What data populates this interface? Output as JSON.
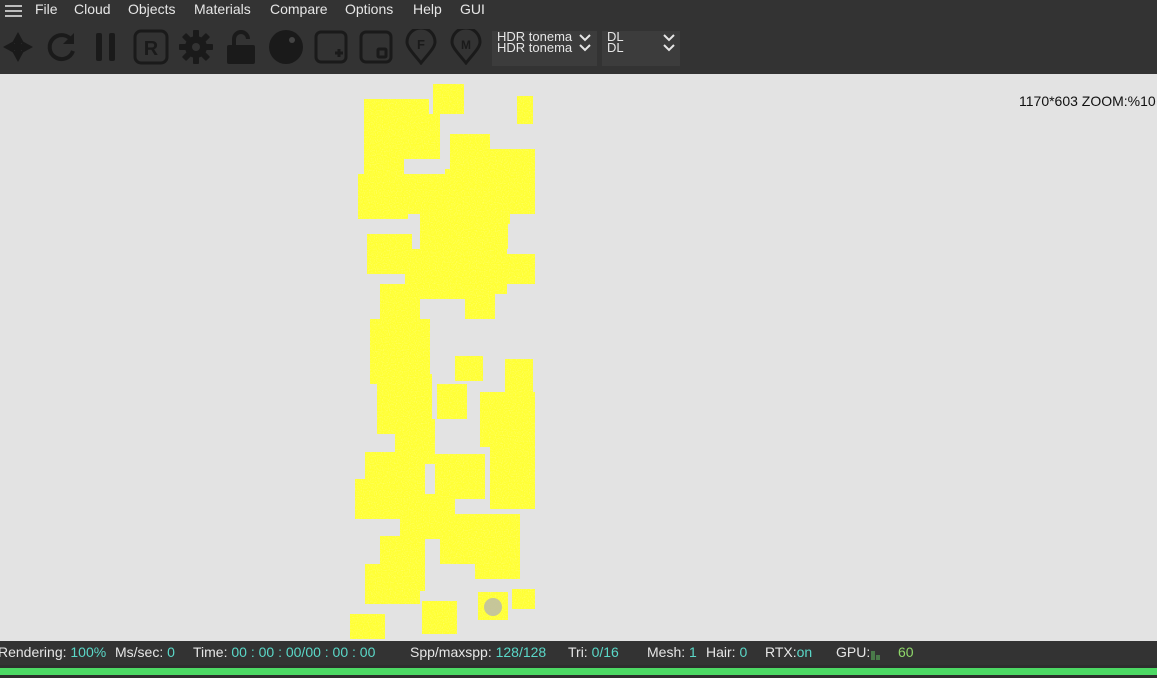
{
  "menu": {
    "items": [
      {
        "label": "File"
      },
      {
        "label": "Cloud"
      },
      {
        "label": "Objects"
      },
      {
        "label": "Materials"
      },
      {
        "label": "Compare"
      },
      {
        "label": "Options"
      },
      {
        "label": "Help"
      },
      {
        "label": "GUI"
      }
    ]
  },
  "toolbar": {
    "icons": [
      "aperture-icon",
      "refresh-icon",
      "pause-icon",
      "render-r-icon",
      "settings-gear-icon",
      "unlock-icon",
      "sphere-icon",
      "add-region-icon",
      "region-select-icon",
      "focus-pin-icon",
      "material-pin-icon"
    ],
    "tonemap_select": {
      "line1": "HDR tonema",
      "line2": "HDR tonema"
    },
    "kernel_select": {
      "line1": "DL",
      "line2": "DL"
    }
  },
  "viewport": {
    "resolution_zoom": "1170*603 ZOOM:%10",
    "background": "#e3e3e3",
    "render_color": "#ffff33"
  },
  "status": {
    "rendering_label": "Rendering:",
    "rendering_value": "100%",
    "ms_label": "Ms/sec:",
    "ms_value": "0",
    "time_label": "Time:",
    "time_value": "00 : 00 : 00/00 : 00 : 00",
    "spp_label": "Spp/maxspp:",
    "spp_value": "128/128",
    "tri_label": "Tri:",
    "tri_value": "0/16",
    "mesh_label": "Mesh:",
    "mesh_value": "1",
    "hair_label": "Hair:",
    "hair_value": "0",
    "rtx_label": "RTX:",
    "rtx_value": "on",
    "gpu_label": "GPU:",
    "gpu_value": "60"
  },
  "progress": {
    "fraction": 1.0,
    "color": "#4cd964"
  }
}
